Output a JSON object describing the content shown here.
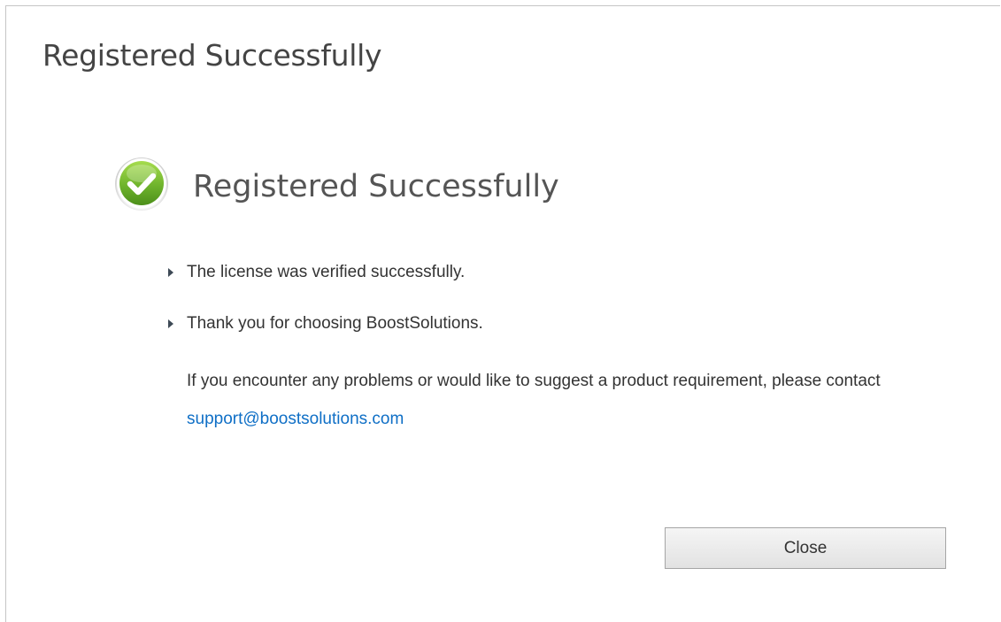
{
  "dialog": {
    "title": "Registered Successfully"
  },
  "content": {
    "icon": "check-circle-icon",
    "icon_color": "#6fb42c",
    "heading": "Registered Successfully",
    "messages": [
      "The license was verified successfully.",
      "Thank you for choosing BoostSolutions."
    ],
    "contact_text": "If you encounter any problems or would like to suggest a product requirement, please contact",
    "contact_email": "support@boostsolutions.com",
    "link_color": "#0f6fc6"
  },
  "footer": {
    "close_label": "Close"
  }
}
